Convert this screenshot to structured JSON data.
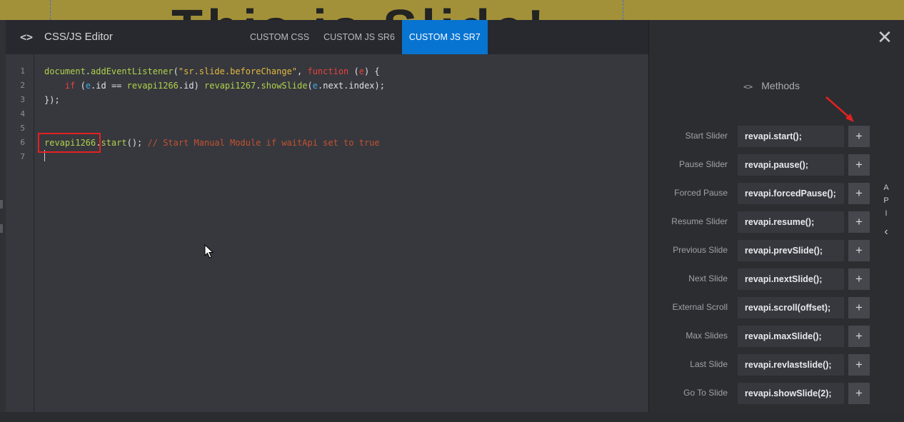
{
  "background": {
    "headline": "This is Slide!"
  },
  "editor_window": {
    "title": "CSS/JS Editor",
    "tabs": [
      {
        "label": "CUSTOM CSS",
        "active": false
      },
      {
        "label": "CUSTOM JS SR6",
        "active": false
      },
      {
        "label": "CUSTOM JS SR7",
        "active": true
      }
    ],
    "accent_color": "#0874d1"
  },
  "code": {
    "line_numbers": [
      "1",
      "2",
      "3",
      "4",
      "5",
      "6",
      "7"
    ],
    "line1": {
      "a": "document",
      "b": ".",
      "c": "addEventListener",
      "d": "(",
      "e": "\"sr.slide.beforeChange\"",
      "f": ", ",
      "g": "function",
      "h": " (",
      "i": "e",
      "j": ") {"
    },
    "line2": {
      "a": "    ",
      "b": "if",
      "c": " (",
      "d": "e",
      "e": ".",
      "f": "id",
      "g": " == ",
      "h": "revapi1266",
      "i": ".",
      "j": "id",
      "k": ") ",
      "l": "revapi1267",
      "m": ".",
      "n": "showSlide",
      "o": "(",
      "p": "e",
      "q": ".",
      "r": "next",
      "s": ".",
      "t": "index",
      "u": ");"
    },
    "line3": "});",
    "line6": {
      "a": "revapi1266",
      "b": ".",
      "c": "start",
      "d": "(); ",
      "e": "// Start Manual Module if waitApi set to true"
    }
  },
  "side_panel": {
    "close_label": "✕",
    "methods_icon": "code-brackets-icon",
    "methods_title": "Methods",
    "methods_icon_glyph": "<>",
    "api_tab_letters": [
      "A",
      "P",
      "I"
    ],
    "collapse_glyph": "‹",
    "methods": [
      {
        "label": "Start Slider",
        "code": "revapi.start();",
        "add": "+"
      },
      {
        "label": "Pause Slider",
        "code": "revapi.pause();",
        "add": "+"
      },
      {
        "label": "Forced Pause",
        "code": "revapi.forcedPause();",
        "add": "+"
      },
      {
        "label": "Resume Slider",
        "code": "revapi.resume();",
        "add": "+"
      },
      {
        "label": "Previous Slide",
        "code": "revapi.prevSlide();",
        "add": "+"
      },
      {
        "label": "Next Slide",
        "code": "revapi.nextSlide();",
        "add": "+"
      },
      {
        "label": "External Scroll",
        "code": "revapi.scroll(offset);",
        "add": "+"
      },
      {
        "label": "Max Slides",
        "code": "revapi.maxSlide();",
        "add": "+"
      },
      {
        "label": "Last Slide",
        "code": "revapi.revlastslide();",
        "add": "+"
      },
      {
        "label": "Go To Slide",
        "code": "revapi.showSlide(2);",
        "add": "+"
      }
    ]
  },
  "annotation_color": "#e32121"
}
